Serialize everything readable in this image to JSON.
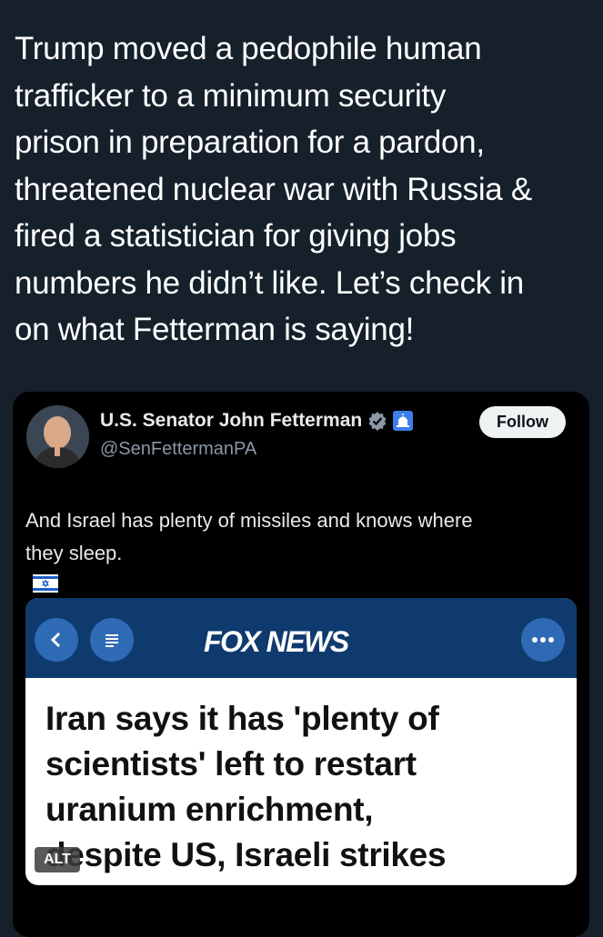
{
  "post": {
    "text_lines": [
      "Trump moved a pedophile human",
      "trafficker to a minimum security",
      "prison in preparation for a pardon,",
      "threatened nuclear war with Russia &",
      "fired a statistician for giving jobs",
      "numbers he didn’t like. Let’s check in",
      "on what Fetterman is saying!"
    ]
  },
  "quoted_post": {
    "display_name": "U.S. Senator John Fetterman",
    "handle": "@SenFettermanPA",
    "follow_label": "Follow",
    "text_lines": [
      "And Israel has plenty of missiles and knows where",
      "they sleep."
    ],
    "badges": [
      "verified-badge-icon",
      "capitol-badge-icon"
    ],
    "flag": "israel-flag-icon"
  },
  "media": {
    "brand": "FOX NEWS",
    "headline_lines": [
      "Iran says it has 'plenty of",
      "scientists' left to restart",
      "uranium enrichment,",
      "despite US, Israeli strikes"
    ],
    "alt_label": "ALT",
    "icons": [
      "back-icon",
      "menu-icon",
      "more-icon"
    ]
  },
  "colors": {
    "background": "#15202b",
    "card": "#000000",
    "fox_bar": "#0e3a6e",
    "fox_button": "#2f6bb5",
    "verified": "#8b98a5",
    "capitol_badge": "#3d7ee8"
  }
}
